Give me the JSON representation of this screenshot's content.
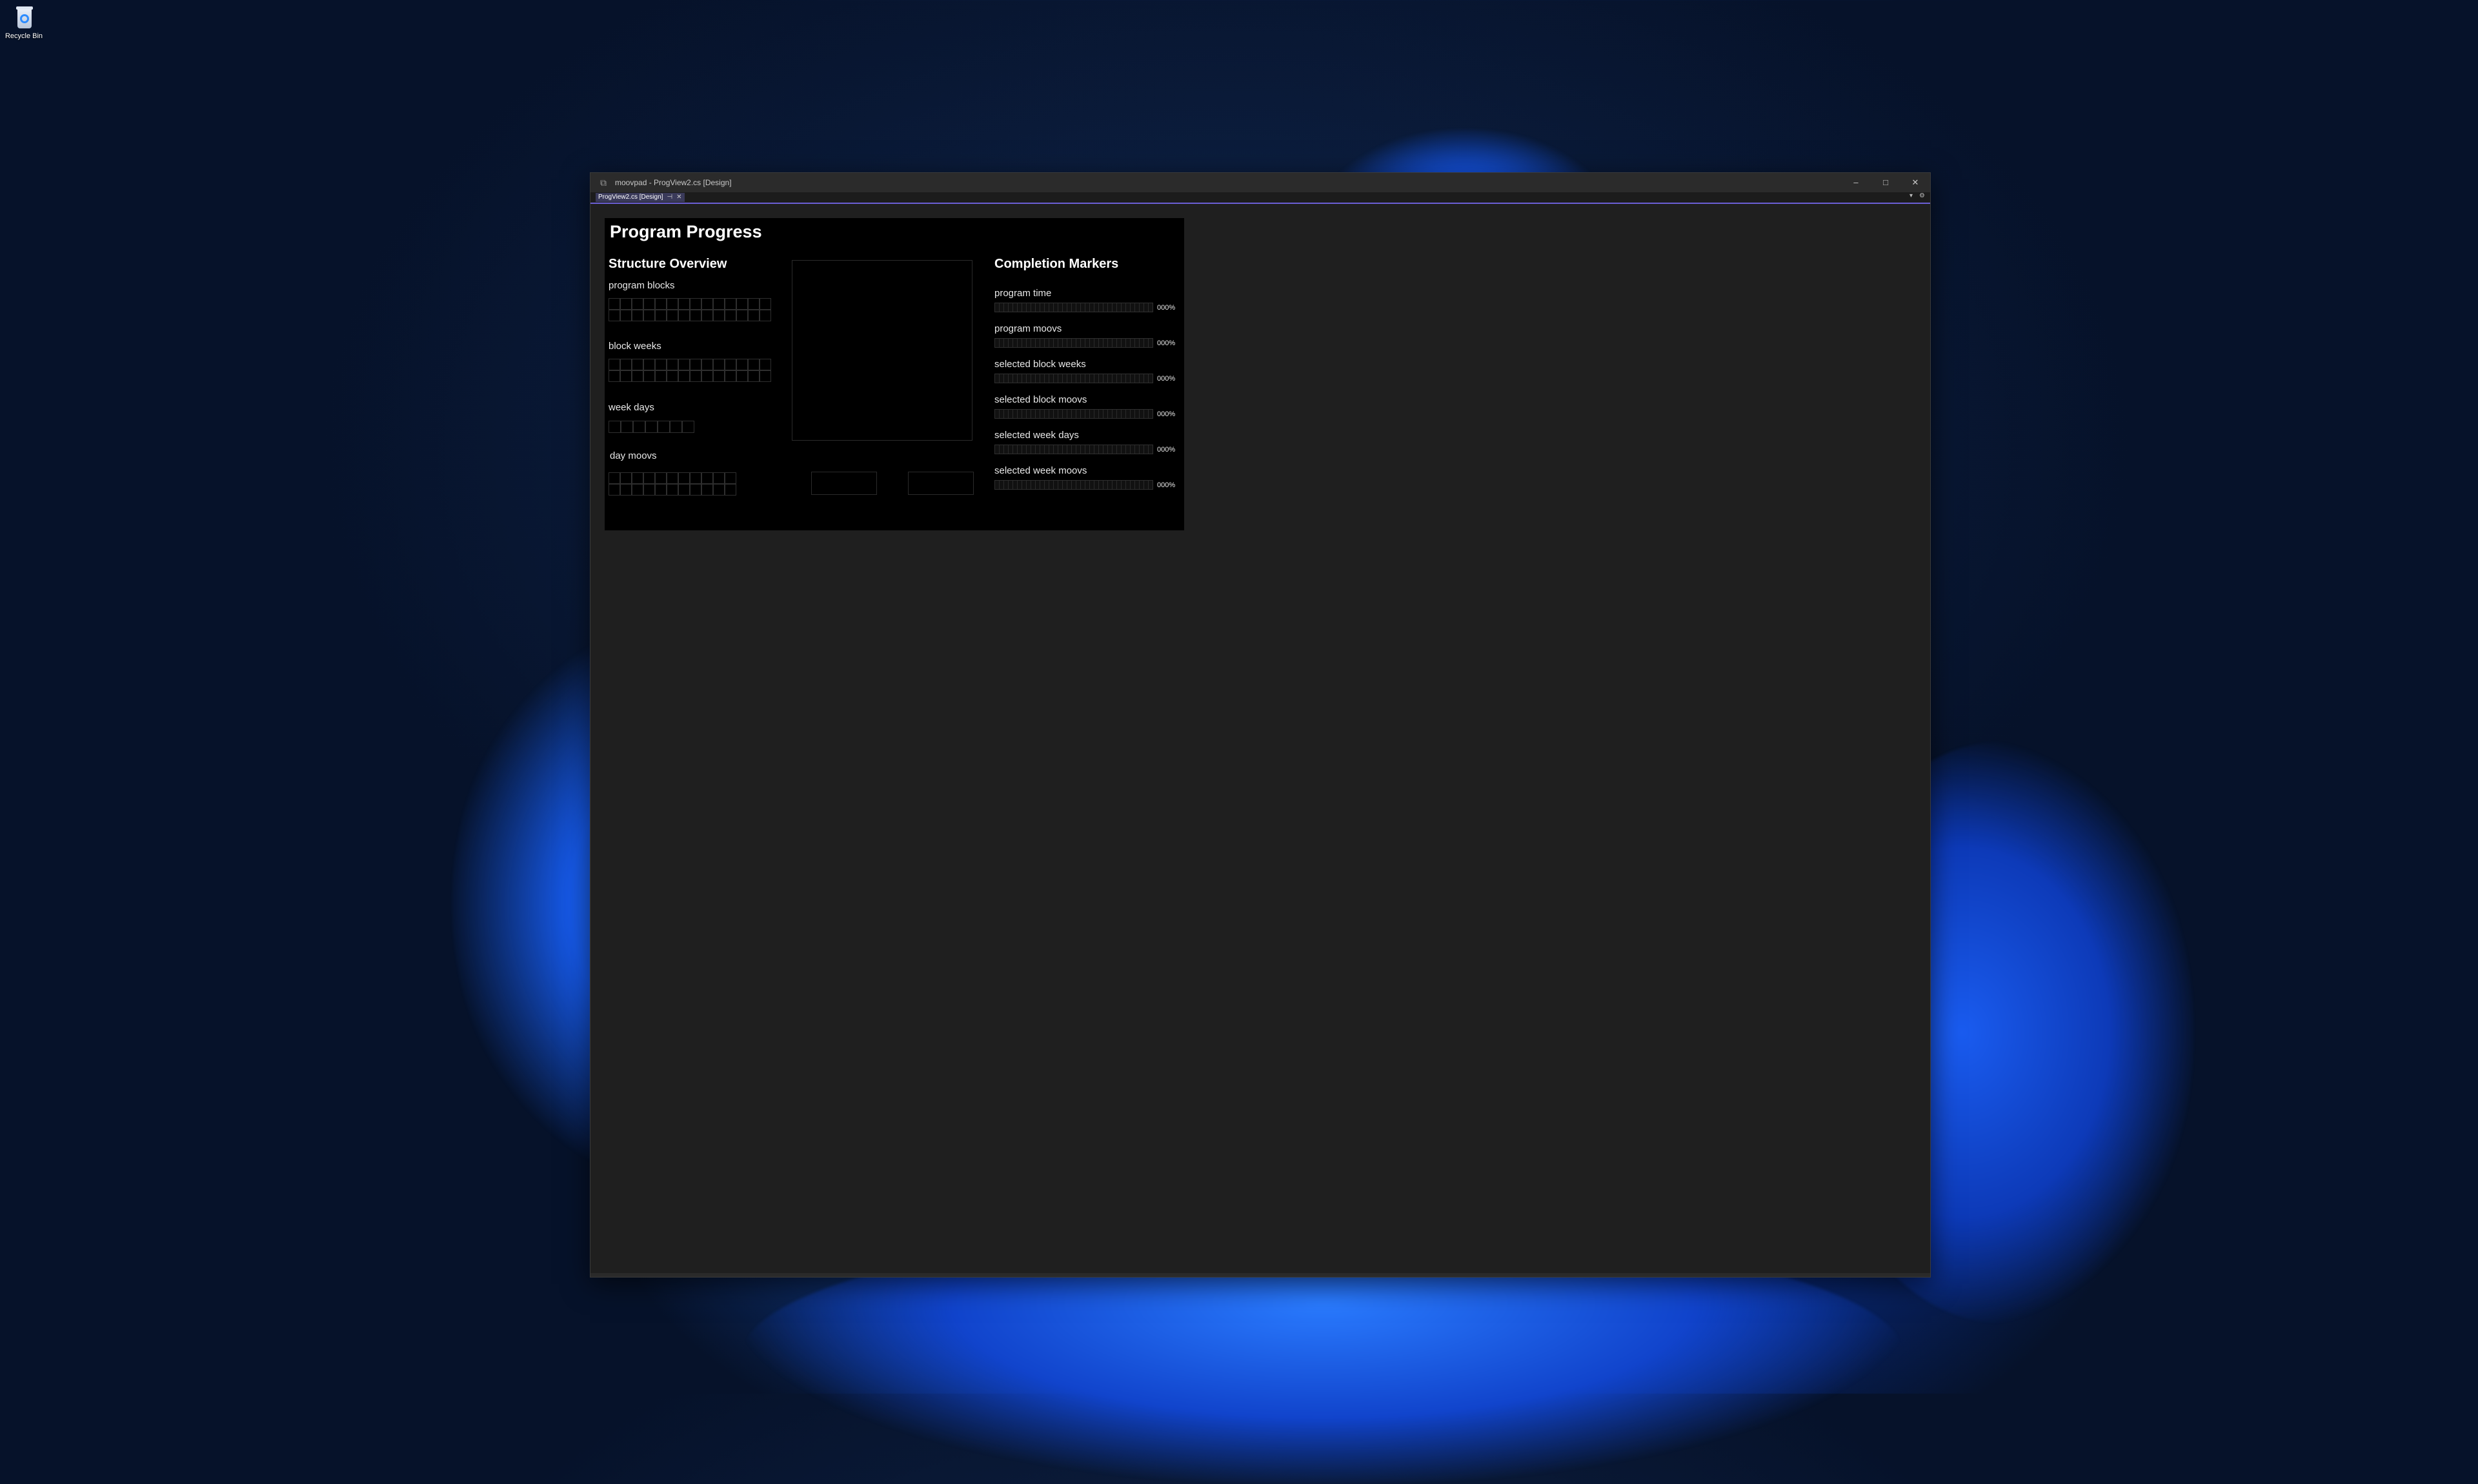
{
  "desktop": {
    "icons": [
      {
        "label": "Recycle Bin"
      }
    ]
  },
  "window": {
    "title": "moovpad - ProgView2.cs [Design]",
    "controls": {
      "minimize": "–",
      "maximize": "□",
      "close": "✕"
    },
    "tabs": [
      {
        "label": "ProgView2.cs [Design]",
        "pin": "⊣",
        "close": "✕",
        "active": true
      }
    ],
    "tabstrip_controls": {
      "dropdown": "▾",
      "settings": "⚙"
    }
  },
  "form": {
    "title": "Program Progress",
    "structure": {
      "title": "Structure Overview",
      "program_blocks": {
        "label": "program blocks",
        "cells": 28
      },
      "block_weeks": {
        "label": "block weeks",
        "cells": 28
      },
      "week_days": {
        "label": "week days",
        "cells": 7
      },
      "day_moovs": {
        "label": "day moovs",
        "cells": 22
      }
    },
    "completion": {
      "title": "Completion Markers",
      "items": [
        {
          "label": "program time",
          "value": 0,
          "pct": "000%"
        },
        {
          "label": "program moovs",
          "value": 0,
          "pct": "000%"
        },
        {
          "label": "selected block weeks",
          "value": 0,
          "pct": "000%"
        },
        {
          "label": "selected block moovs",
          "value": 0,
          "pct": "000%"
        },
        {
          "label": "selected week days",
          "value": 0,
          "pct": "000%"
        },
        {
          "label": "selected week moovs",
          "value": 0,
          "pct": "000%"
        }
      ]
    }
  },
  "colors": {
    "accent": "#6b5fd6",
    "form_background": "#000000",
    "workspace_background": "#1f1f1f"
  }
}
